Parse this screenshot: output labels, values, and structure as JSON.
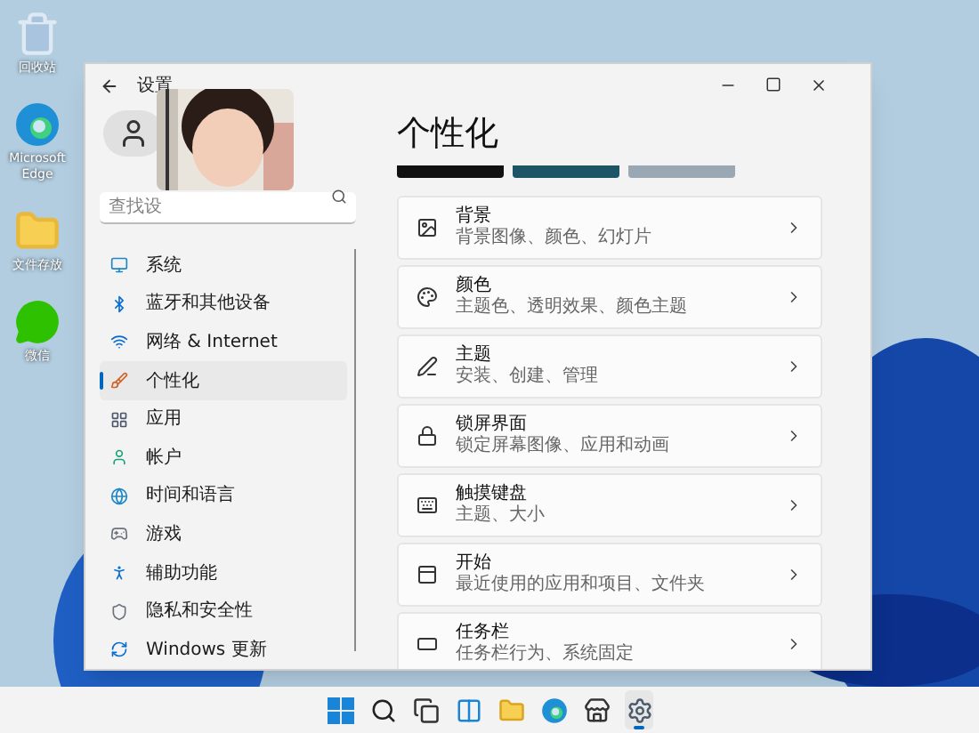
{
  "desktop_icons": [
    {
      "kind": "recycle",
      "label": "回收站"
    },
    {
      "kind": "edge",
      "label": "Microsoft Edge"
    },
    {
      "kind": "folder",
      "label": "文件存放"
    },
    {
      "kind": "wechat",
      "label": "微信"
    }
  ],
  "window": {
    "title": "设置"
  },
  "search": {
    "placeholder": "查找设"
  },
  "nav": [
    {
      "kind": "system",
      "label": "系统",
      "selected": false
    },
    {
      "kind": "bluetooth",
      "label": "蓝牙和其他设备",
      "selected": false
    },
    {
      "kind": "network",
      "label": "网络 & Internet",
      "selected": false
    },
    {
      "kind": "personalize",
      "label": "个性化",
      "selected": true
    },
    {
      "kind": "apps",
      "label": "应用",
      "selected": false
    },
    {
      "kind": "account",
      "label": "帐户",
      "selected": false
    },
    {
      "kind": "time",
      "label": "时间和语言",
      "selected": false
    },
    {
      "kind": "gaming",
      "label": "游戏",
      "selected": false
    },
    {
      "kind": "access",
      "label": "辅助功能",
      "selected": false
    },
    {
      "kind": "privacy",
      "label": "隐私和安全性",
      "selected": false
    },
    {
      "kind": "update",
      "label": "Windows 更新",
      "selected": false
    }
  ],
  "page_title": "个性化",
  "cards": [
    {
      "title": "背景",
      "subtitle": "背景图像、颜色、幻灯片"
    },
    {
      "kind": "palette",
      "title": "颜色",
      "subtitle": "主题色、透明效果、颜色主题"
    },
    {
      "kind": "pen",
      "title": "主题",
      "subtitle": "安装、创建、管理"
    },
    {
      "kind": "lock",
      "title": "锁屏界面",
      "subtitle": "锁定屏幕图像、应用和动画"
    },
    {
      "kind": "keyboard",
      "title": "触摸键盘",
      "subtitle": "主题、大小"
    },
    {
      "kind": "start",
      "title": "开始",
      "subtitle": "最近使用的应用和项目、文件夹"
    },
    {
      "kind": "taskbar",
      "title": "任务栏",
      "subtitle": "任务栏行为、系统固定"
    }
  ],
  "taskbar": [
    {
      "kind": "start",
      "active": false
    },
    {
      "kind": "search",
      "active": false
    },
    {
      "kind": "taskview",
      "active": false
    },
    {
      "kind": "widgets",
      "active": false
    },
    {
      "kind": "explorer",
      "active": false
    },
    {
      "kind": "edge",
      "active": false
    },
    {
      "kind": "store",
      "active": false
    },
    {
      "kind": "settings",
      "active": true
    }
  ]
}
